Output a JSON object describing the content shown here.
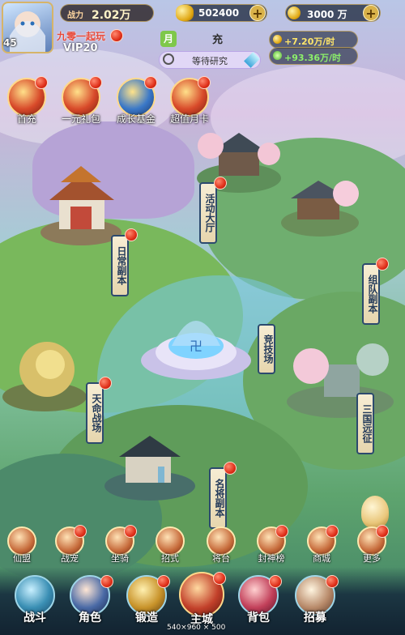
{
  "player": {
    "level": "45",
    "power_label": "战力",
    "power_value": "2.02万",
    "banner_text": "九零一起玩",
    "vip": "VIP20"
  },
  "currency": {
    "silver": "502400",
    "gold": "3000 万",
    "silver_rate": "+7.20万/时",
    "exp_rate": "+93.36万/时"
  },
  "top_actions": {
    "recharge": "充",
    "research_status": "等待研究"
  },
  "features": [
    {
      "label": "首充"
    },
    {
      "label": "一元礼包"
    },
    {
      "label": "成长基金"
    },
    {
      "label": "超值月卡"
    }
  ],
  "map_locations": {
    "activity_hall": "活动大厅",
    "daily_dungeon": "日常副本",
    "team_dungeon": "组队副本",
    "arena": "竞技场",
    "destiny_battle": "天命战场",
    "three_kingdoms": "三国远征",
    "hero_dungeon": "名将副本"
  },
  "sub_nav": [
    {
      "label": "仙盟"
    },
    {
      "label": "战宠"
    },
    {
      "label": "坐骑"
    },
    {
      "label": "招式"
    },
    {
      "label": "将台"
    },
    {
      "label": "封神榜"
    },
    {
      "label": "商城"
    },
    {
      "label": "更多"
    }
  ],
  "main_nav": [
    {
      "label": "战斗"
    },
    {
      "label": "角色"
    },
    {
      "label": "锻造"
    },
    {
      "label": "主城"
    },
    {
      "label": "背包"
    },
    {
      "label": "招募"
    }
  ],
  "resolution_text": "540×960 × 500",
  "colors": {
    "accent_gold": "#d9b24a",
    "badge_red": "#e0301a",
    "gain_green": "#8cf06a",
    "gain_yellow": "#ffe66a"
  }
}
